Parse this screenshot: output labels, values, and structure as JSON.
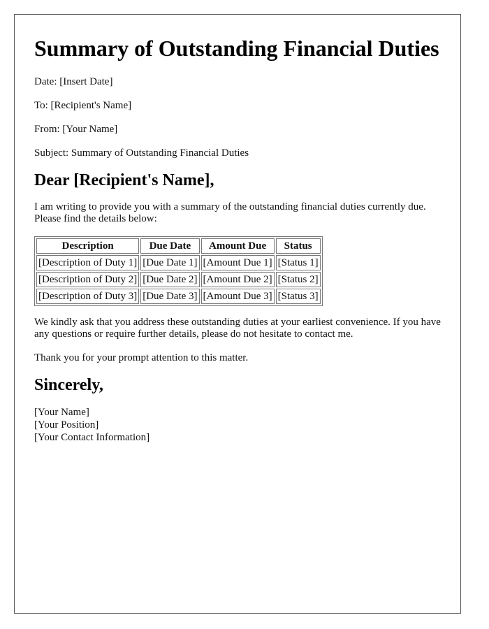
{
  "title": "Summary of Outstanding Financial Duties",
  "meta": {
    "date": "Date: [Insert Date]",
    "to": "To: [Recipient's Name]",
    "from": "From: [Your Name]",
    "subject": "Subject: Summary of Outstanding Financial Duties"
  },
  "salutation": "Dear [Recipient's Name],",
  "intro": "I am writing to provide you with a summary of the outstanding financial duties currently due. Please find the details below:",
  "table": {
    "headers": [
      "Description",
      "Due Date",
      "Amount Due",
      "Status"
    ],
    "rows": [
      [
        "[Description of Duty 1]",
        "[Due Date 1]",
        "[Amount Due 1]",
        "[Status 1]"
      ],
      [
        "[Description of Duty 2]",
        "[Due Date 2]",
        "[Amount Due 2]",
        "[Status 2]"
      ],
      [
        "[Description of Duty 3]",
        "[Due Date 3]",
        "[Amount Due 3]",
        "[Status 3]"
      ]
    ]
  },
  "closing_paragraph": "We kindly ask that you address these outstanding duties at your earliest convenience. If you have any questions or require further details, please do not hesitate to contact me.",
  "thanks": "Thank you for your prompt attention to this matter.",
  "sign_off": "Sincerely,",
  "signature": {
    "name": "[Your Name]",
    "position": "[Your Position]",
    "contact": "[Your Contact Information]"
  }
}
